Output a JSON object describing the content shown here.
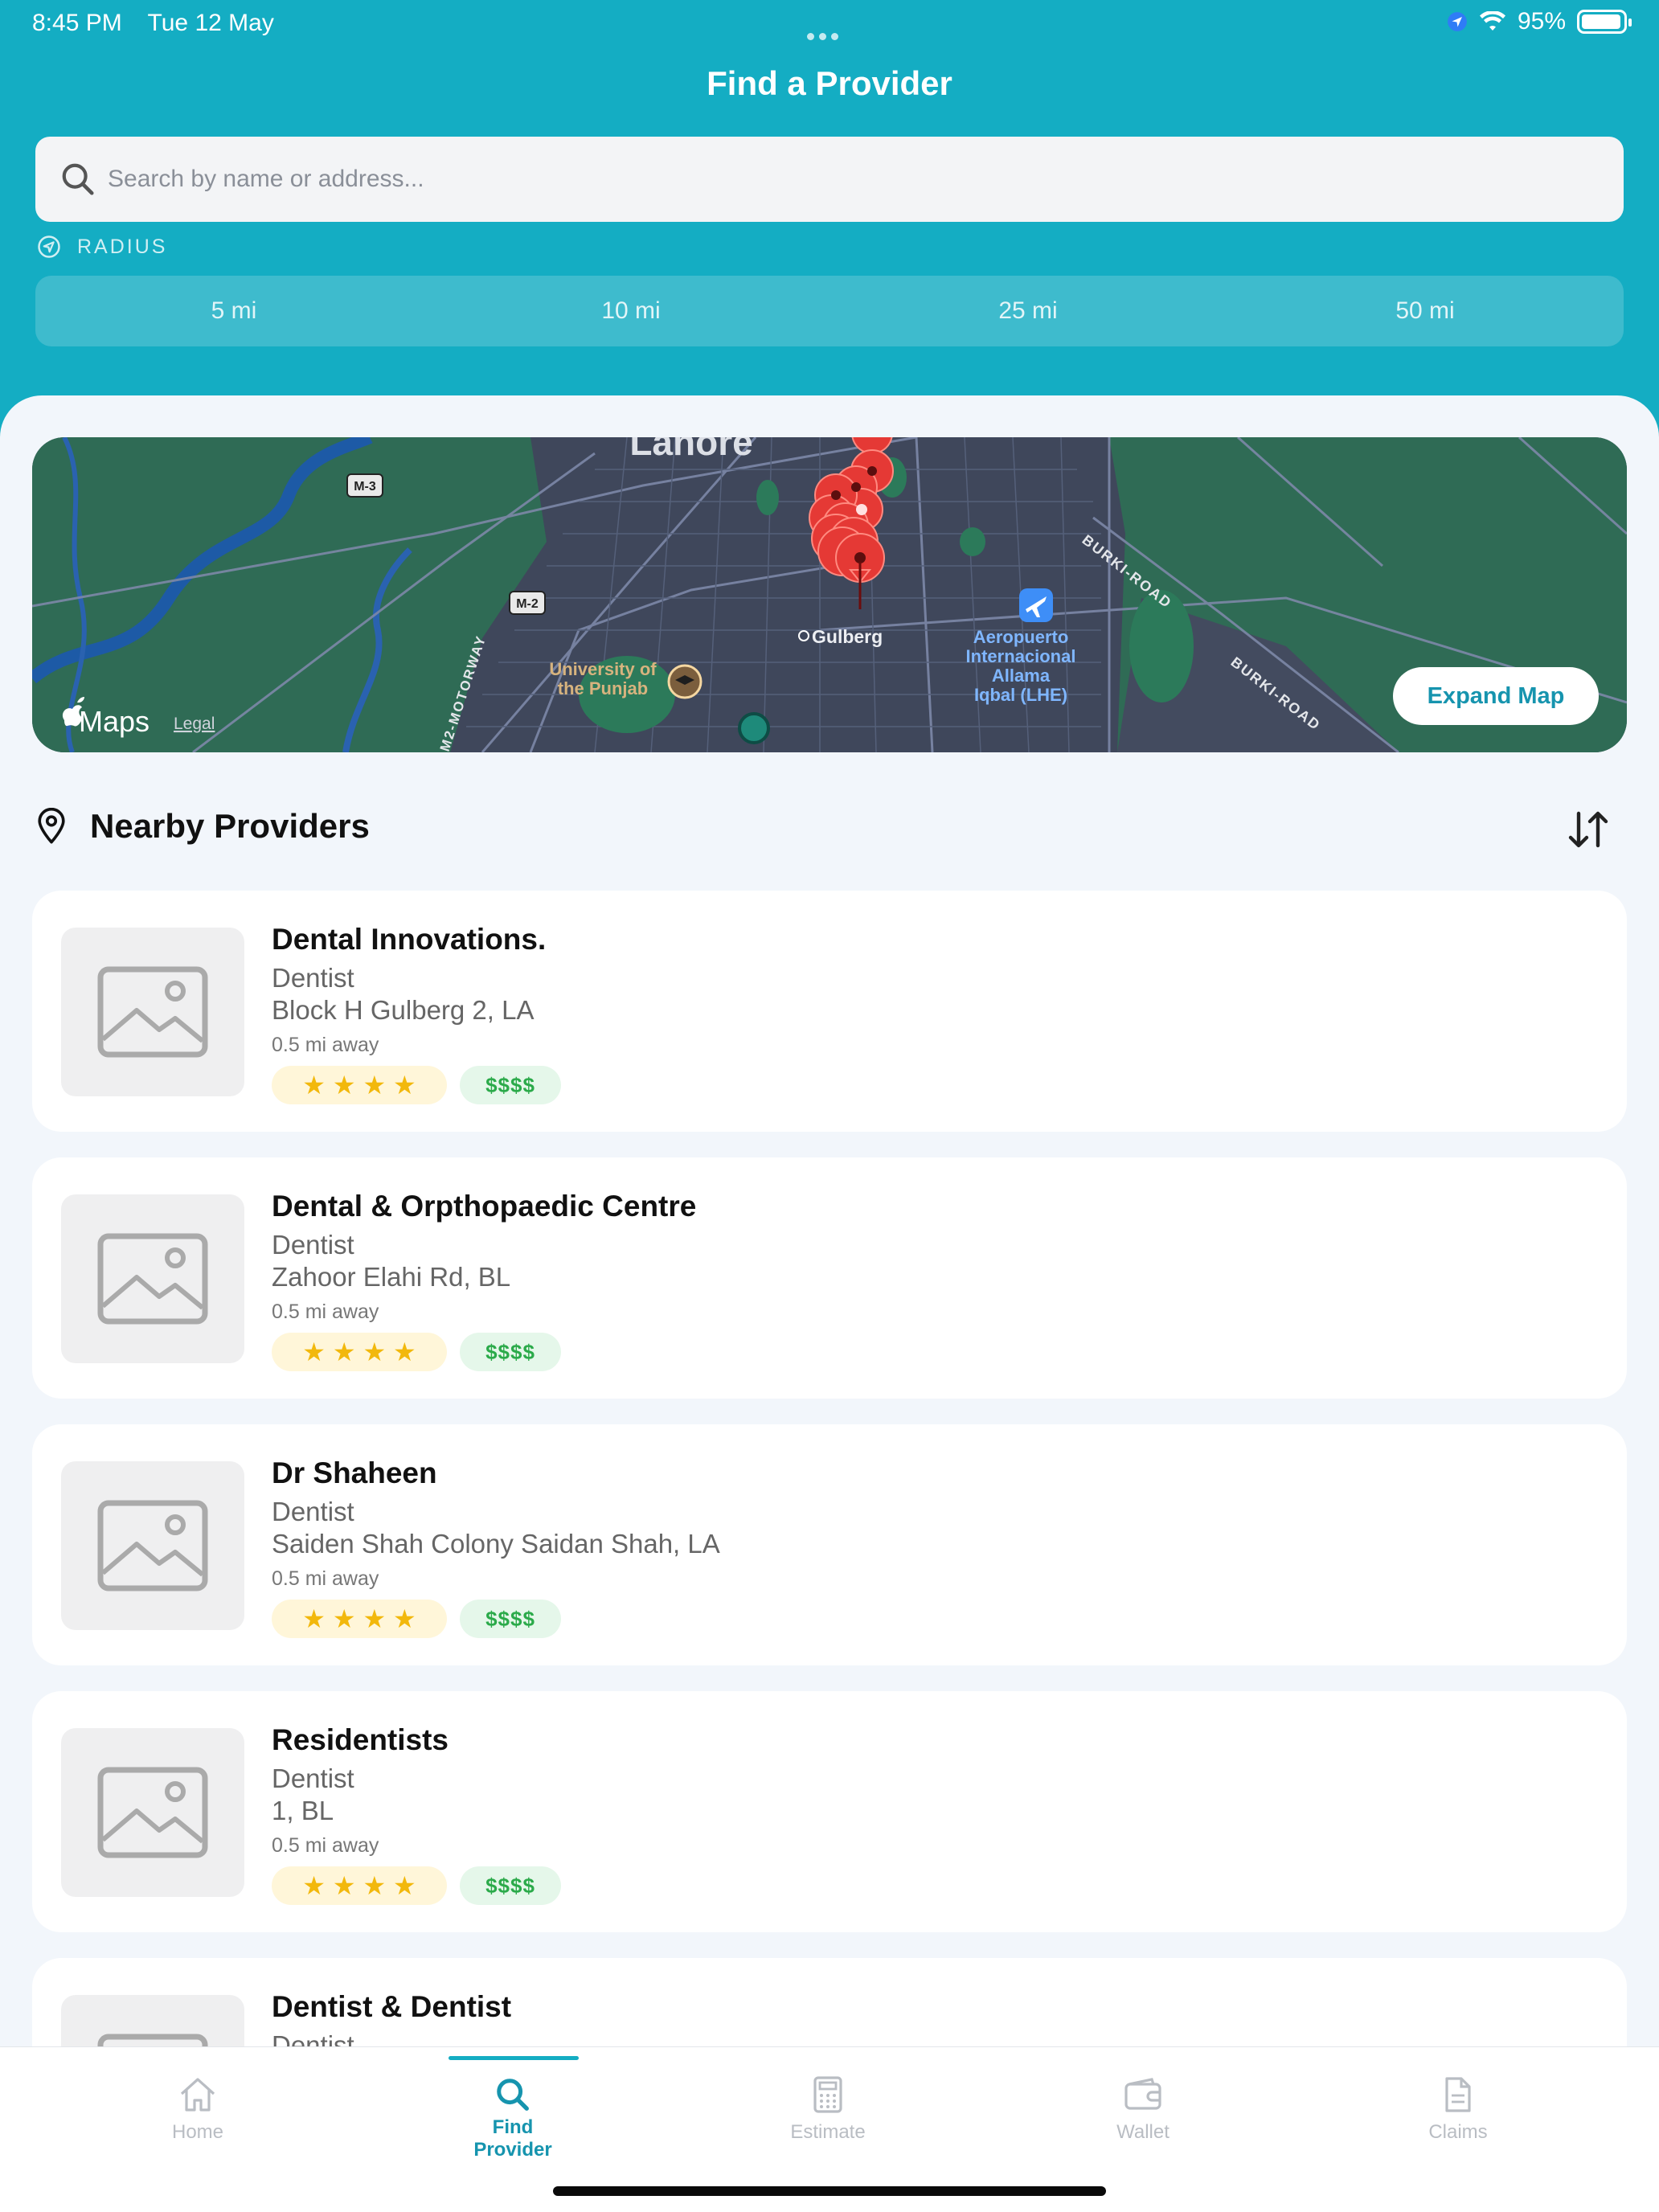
{
  "status_bar": {
    "time": "8:45 PM",
    "date": "Tue 12 May",
    "battery": "95%",
    "battery_level": 0.95
  },
  "header": {
    "title": "Find a Provider",
    "search_placeholder": "Search by name or address...",
    "radius_label": "RADIUS",
    "radius_options": [
      "5 mi",
      "10 mi",
      "25 mi",
      "50 mi"
    ]
  },
  "map": {
    "city_label": "Lahore",
    "area_label": "Gulberg",
    "university_label_1": "University of",
    "university_label_2": "the Punjab",
    "airport_label_1": "Aeropuerto",
    "airport_label_2": "Internacional",
    "airport_label_3": "Allama",
    "airport_label_4": "Iqbal (LHE)",
    "road_burki_1": "BURKI-ROAD",
    "road_burki_2": "BURKI-ROAD",
    "road_motorway": "M2-MOTORWAY",
    "shield_m3": "M-3",
    "shield_m2": "M-2",
    "maps_brand": "Maps",
    "legal": "Legal",
    "expand_button": "Expand Map"
  },
  "section": {
    "title": "Nearby Providers"
  },
  "providers": [
    {
      "name": "Dental Innovations.",
      "type": "Dentist",
      "address": "Block H Gulberg 2, LA",
      "distance": "0.5 mi away",
      "stars": "★ ★ ★ ★",
      "price": "$$$$"
    },
    {
      "name": "Dental & Orpthopaedic Centre",
      "type": "Dentist",
      "address": "Zahoor Elahi Rd, BL",
      "distance": "0.5 mi away",
      "stars": "★ ★ ★ ★",
      "price": "$$$$"
    },
    {
      "name": "Dr Shaheen",
      "type": "Dentist",
      "address": "Saiden Shah Colony Saidan Shah, LA",
      "distance": "0.5 mi away",
      "stars": "★ ★ ★ ★",
      "price": "$$$$"
    },
    {
      "name": "Residentists",
      "type": "Dentist",
      "address": "1, BL",
      "distance": "0.5 mi away",
      "stars": "★ ★ ★ ★",
      "price": "$$$$"
    },
    {
      "name": "Dentist & Dentist",
      "type": "Dentist"
    }
  ],
  "tabs": [
    {
      "label": "Home",
      "icon": "home-icon"
    },
    {
      "label": "Find Provider",
      "icon": "search-icon"
    },
    {
      "label": "Estimate",
      "icon": "calculator-icon"
    },
    {
      "label": "Wallet",
      "icon": "wallet-icon"
    },
    {
      "label": "Claims",
      "icon": "document-icon"
    }
  ],
  "colors": {
    "header": "#14ADC3",
    "accent": "#1694AE",
    "star": "#F2B80C",
    "price": "#2BAA4A"
  }
}
